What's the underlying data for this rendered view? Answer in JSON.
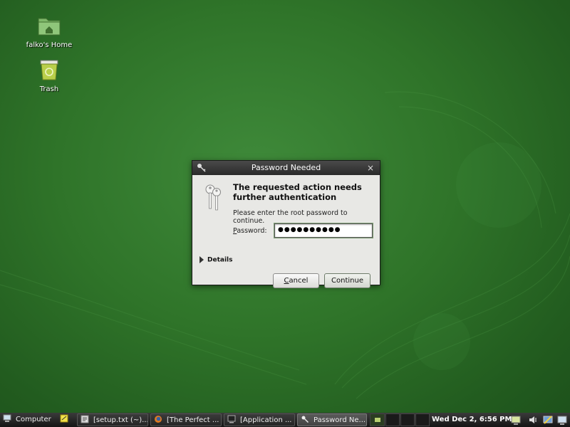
{
  "desktop": {
    "icons": [
      {
        "label": "falko's Home",
        "icon": "home-folder-icon"
      },
      {
        "label": "Trash",
        "icon": "trash-icon"
      }
    ]
  },
  "dialog": {
    "title": "Password Needed",
    "close": "×",
    "heading": "The requested action needs further authentication",
    "message": "Please enter the root password to continue.",
    "password_label_accel": "P",
    "password_label_rest": "assword:",
    "password_value": "●●●●●●●●●●",
    "details_label": "Details",
    "cancel_accel": "C",
    "cancel_rest": "ancel",
    "continue_label": "Continue"
  },
  "taskbar": {
    "computer_label": "Computer",
    "tasks": [
      {
        "label": "[setup.txt (~)...",
        "icon": "text-editor-icon"
      },
      {
        "label": "[The Perfect ...",
        "icon": "firefox-icon"
      },
      {
        "label": "[Application ...",
        "icon": "terminal-icon"
      },
      {
        "label": "Password Ne...",
        "icon": "keys-icon",
        "active": true
      }
    ],
    "clock": "Wed Dec  2,  6:56 PM"
  },
  "colors": {
    "desktop_green": "#2f7429",
    "dialog_bg": "#e8e8e5",
    "titlebar": "#2a2a2a",
    "taskbar": "#151515"
  }
}
